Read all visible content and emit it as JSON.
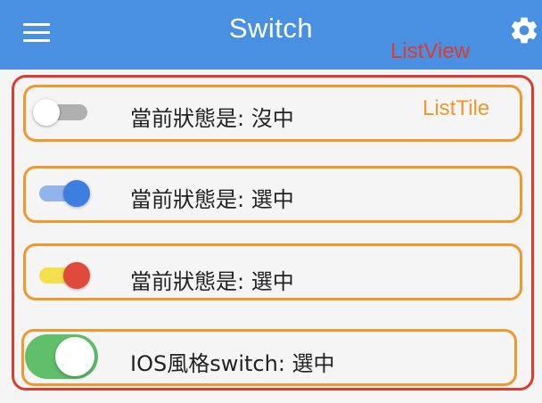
{
  "appbar": {
    "title": "Switch",
    "bg_color": "#4a90e2",
    "left_icon": "menu-icon",
    "right_icon": "gear-icon"
  },
  "annotations": {
    "listview_label": "ListView",
    "listview_color": "#e03a2e",
    "listtile_label": "ListTile",
    "listtile_color": "#f0982c"
  },
  "tiles": [
    {
      "text": "當前狀態是: 沒中",
      "switch": "material",
      "on": false,
      "thumb_color": "#ffffff",
      "track_color": "#b0b0b0"
    },
    {
      "text": "當前狀態是: 選中",
      "switch": "material",
      "on": true,
      "thumb_color": "#3d7fe0",
      "track_color": "#8fb5ec"
    },
    {
      "text": "當前狀態是: 選中",
      "switch": "material",
      "on": true,
      "thumb_color": "#e04a3a",
      "track_color": "#f4e04c"
    },
    {
      "text": "IOS風格switch: 選中",
      "switch": "cupertino",
      "on": true,
      "thumb_color": "#ffffff",
      "track_color": "#5fbf6b"
    }
  ]
}
